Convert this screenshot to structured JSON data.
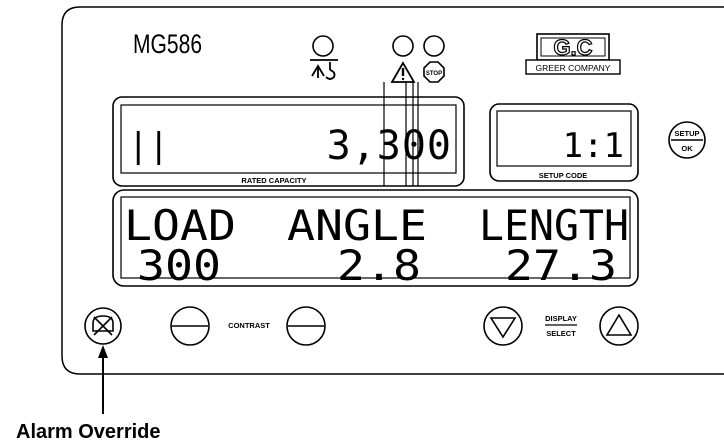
{
  "panel": {
    "model": "MG586",
    "brand": {
      "initials": "G.C",
      "name": "GREER COMPANY"
    },
    "rated_capacity": {
      "prefix": "||",
      "value": "3,300",
      "label": "RATED CAPACITY"
    },
    "setup_code": {
      "value": "1:1",
      "label": "SETUP CODE"
    },
    "setup_button": {
      "top": "SETUP",
      "bottom": "OK"
    },
    "stop_label": "STOP",
    "main_display": {
      "headers": [
        "LOAD",
        "ANGLE",
        "LENGTH"
      ],
      "values": [
        "300",
        "2.8",
        "27.3"
      ]
    },
    "contrast_label": "CONTRAST",
    "display_select": {
      "top": "DISPLAY",
      "bottom": "SELECT"
    }
  },
  "callout": {
    "label": "Alarm Override"
  },
  "icons": [
    "circle-light-icon",
    "crane-hook-icon",
    "warning-triangle-icon",
    "stop-sign-icon",
    "alarm-mute-icon",
    "minus-icon",
    "plus-icon",
    "down-arrow-icon",
    "up-arrow-icon"
  ]
}
